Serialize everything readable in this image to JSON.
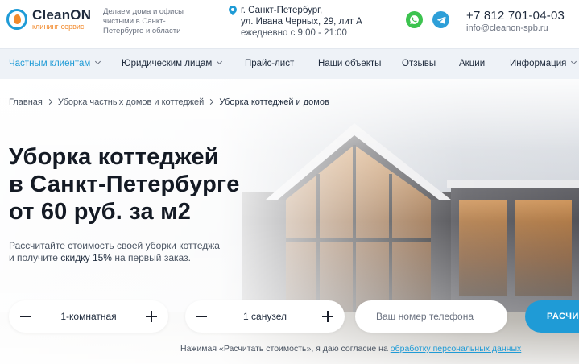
{
  "header": {
    "logo": {
      "name": "CleanON",
      "subtitle": "клининг-сервис"
    },
    "tagline": "Делаем дома и офисы чистыми в Санкт-Петербурге и области",
    "address": {
      "line1": "г. Санкт-Петербург,",
      "line2": "ул. Ивана Черных, 29, лит А",
      "hours": "ежедневно с 9:00 - 21:00"
    },
    "messengers": {
      "whatsapp_icon": "whatsapp-icon",
      "telegram_icon": "telegram-icon"
    },
    "phone": "+7 812 701-04-03",
    "email": "info@cleanon-spb.ru"
  },
  "nav": {
    "items": [
      {
        "label": "Частным клиентам",
        "dropdown": true,
        "active": true
      },
      {
        "label": "Юридическим лицам",
        "dropdown": true
      },
      {
        "label": "Прайс-лист"
      },
      {
        "label": "Наши объекты"
      },
      {
        "label": "Отзывы"
      },
      {
        "label": "Акции"
      },
      {
        "label": "Информация",
        "dropdown": true
      }
    ]
  },
  "breadcrumb": {
    "items": [
      "Главная",
      "Уборка частных домов и коттеджей",
      "Уборка коттеджей и домов"
    ]
  },
  "hero": {
    "title_line1": "Уборка коттеджей",
    "title_line2": "в Санкт-Петербурге",
    "title_line3": "от 60 руб. за м2",
    "lead_line1": "Рассчитайте стоимость своей уборки коттеджа",
    "lead_prefix": "и получите",
    "lead_accent": "скидку 15%",
    "lead_suffix": "на первый заказ."
  },
  "form": {
    "rooms_value": "1-комнатная",
    "bathrooms_value": "1 санузел",
    "phone_placeholder": "Ваш номер телефона",
    "submit_label": "РАСЧИТАТЬ",
    "consent_text": "Нажимая «Расчитать стоимость», я даю согласие на",
    "consent_link": "обработку персональных данных"
  },
  "colors": {
    "accent": "#1f9bd6",
    "logo_orange": "#f28a2c",
    "whatsapp": "#3cc34f",
    "telegram": "#2e9fd8"
  }
}
